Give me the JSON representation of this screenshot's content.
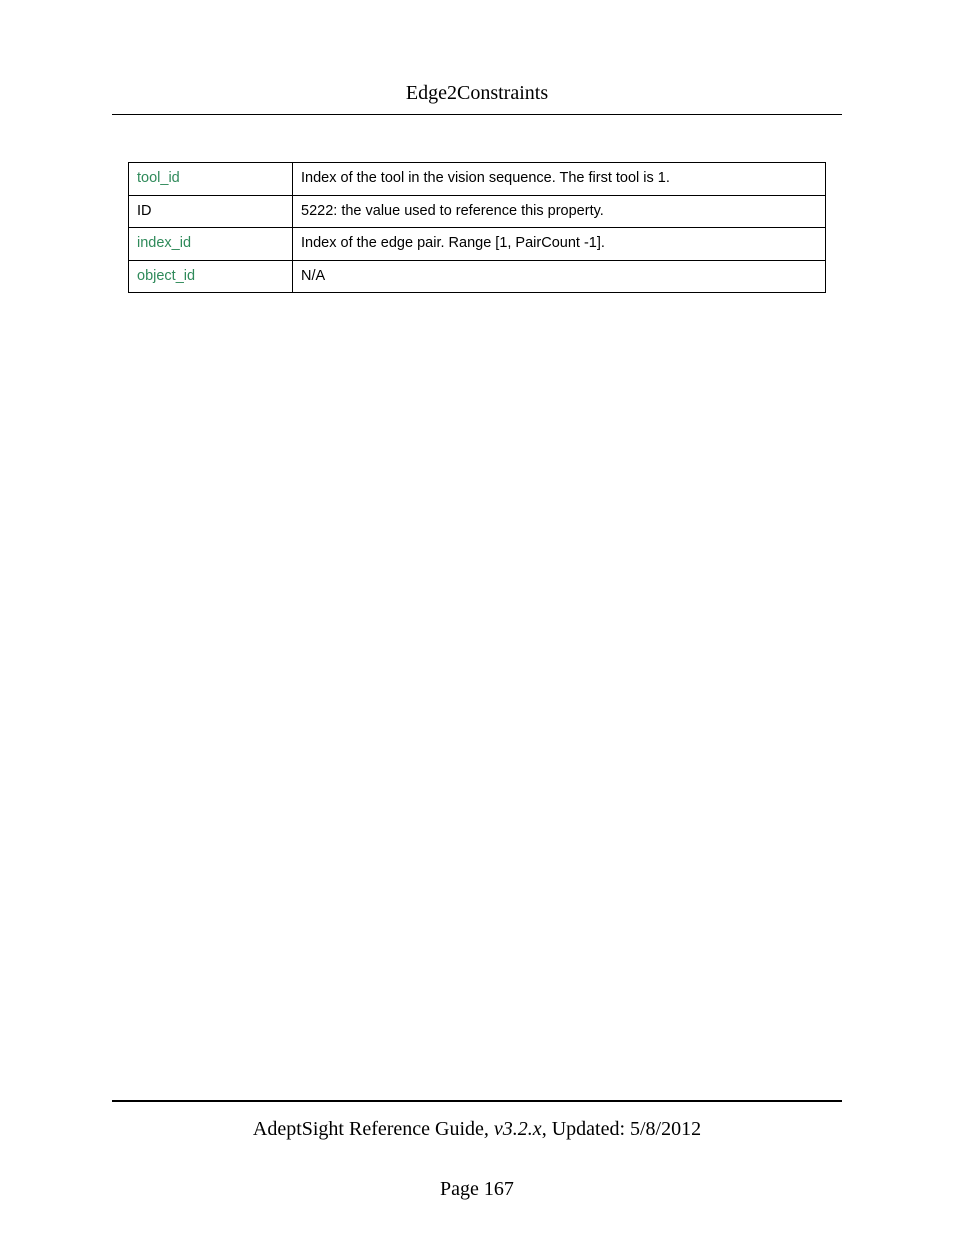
{
  "header": {
    "title": "Edge2Constraints"
  },
  "table": {
    "rows": [
      {
        "key": "tool_id",
        "is_link": true,
        "desc": "Index of the tool in the vision sequence. The first tool is 1."
      },
      {
        "key": "ID",
        "is_link": false,
        "desc": "5222: the value used to reference this property."
      },
      {
        "key": "index_id",
        "is_link": true,
        "desc": "Index of the edge pair. Range [1, PairCount -1]."
      },
      {
        "key": "object_id",
        "is_link": true,
        "desc": "N/A"
      }
    ]
  },
  "footer": {
    "guide_name": "AdeptSight Reference Guide",
    "version_prefix": ", ",
    "version": "v3.2.x",
    "updated_prefix": ", Updated: ",
    "updated": "5/8/2012",
    "page_label": "Page 167"
  }
}
